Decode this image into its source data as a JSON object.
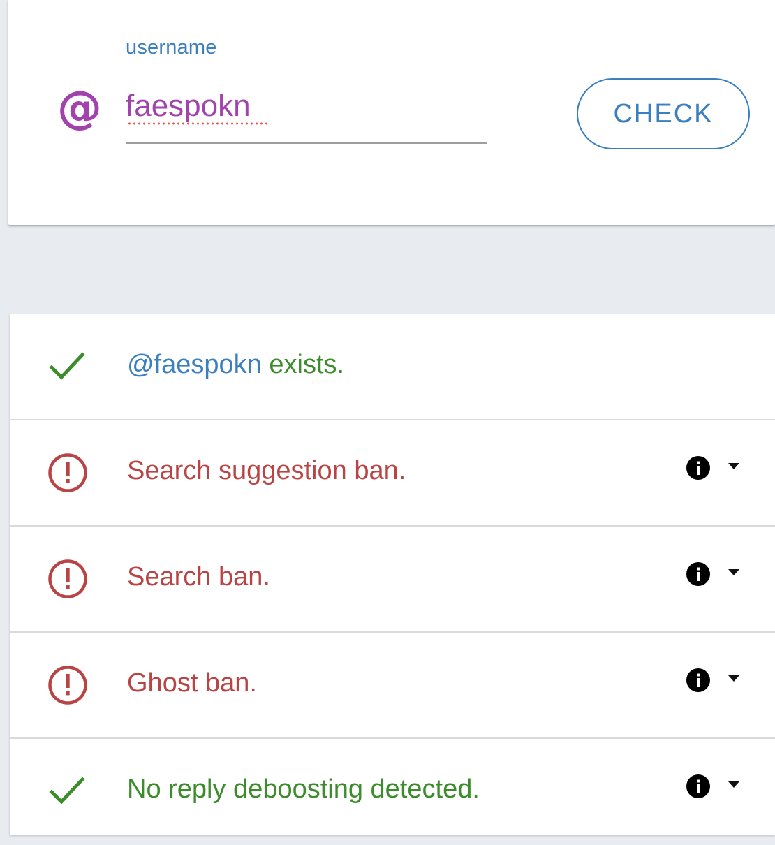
{
  "search": {
    "label": "username",
    "at_symbol": "@",
    "value": "faespokn",
    "button_label": "CHECK"
  },
  "colors": {
    "accent_blue": "#3b7fbf",
    "accent_purple": "#a142ad",
    "ok_green": "#3c8c2c",
    "ban_red": "#b84444"
  },
  "results": [
    {
      "status": "ok",
      "icon": "checkmark-icon",
      "handle": "@faespokn",
      "text": " exists.",
      "has_info": false
    },
    {
      "status": "ban",
      "icon": "alert-circle-icon",
      "text": "Search suggestion ban.",
      "has_info": true
    },
    {
      "status": "ban",
      "icon": "alert-circle-icon",
      "text": "Search ban.",
      "has_info": true
    },
    {
      "status": "ban",
      "icon": "alert-circle-icon",
      "text": "Ghost ban.",
      "has_info": true
    },
    {
      "status": "ok",
      "icon": "checkmark-icon",
      "text": "No reply deboosting detected.",
      "has_info": true
    }
  ]
}
